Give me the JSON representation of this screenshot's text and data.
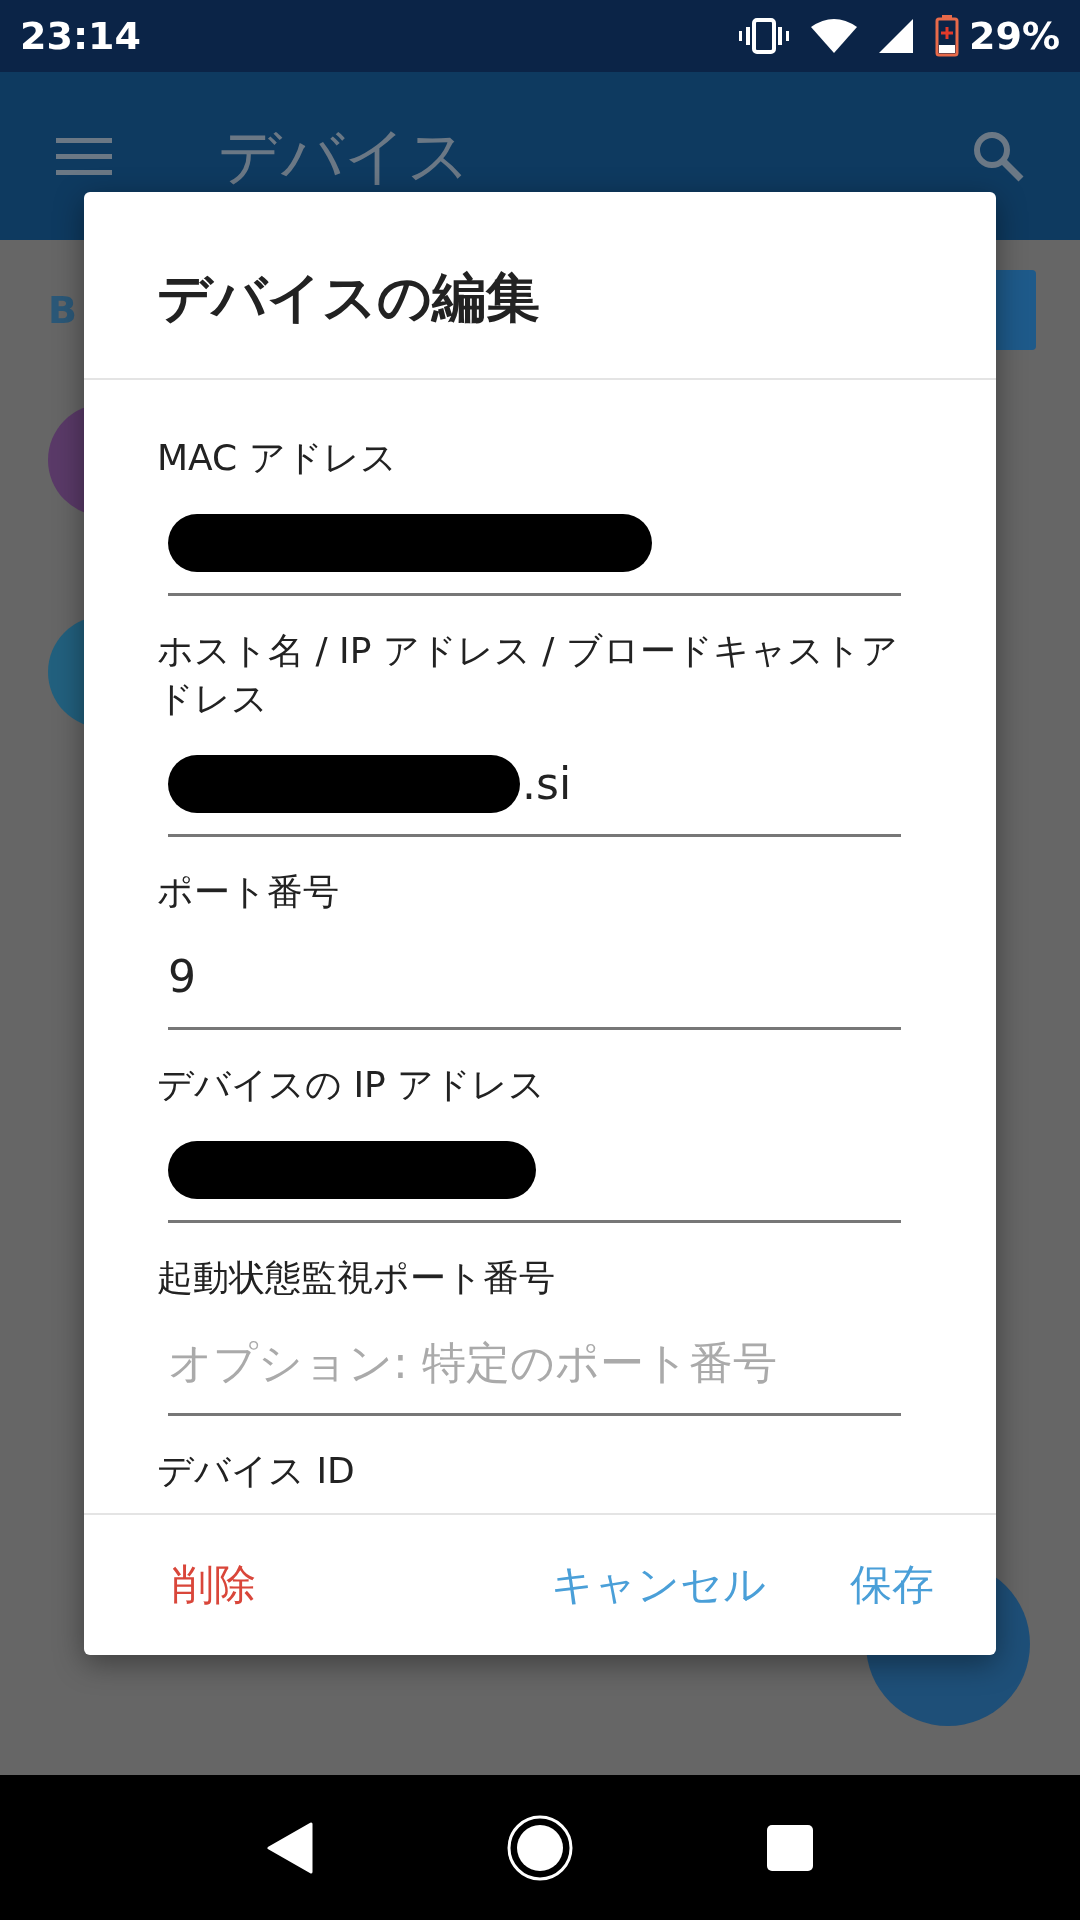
{
  "status_bar": {
    "time": "23:14",
    "battery": "29%"
  },
  "app_bar": {
    "title": "デバイス"
  },
  "background": {
    "section_label": "B"
  },
  "dialog": {
    "title": "デバイスの編集",
    "fields": [
      {
        "label": "MAC アドレス",
        "kind": "redacted"
      },
      {
        "label": "ホスト名 / IP アドレス / ブロードキャストアドレス",
        "kind": "redacted",
        "value": ".si"
      },
      {
        "label": "ポート番号",
        "kind": "text",
        "value": "9"
      },
      {
        "label": "デバイスの IP アドレス",
        "kind": "redacted"
      },
      {
        "label": "起動状態監視ポート番号",
        "kind": "text",
        "placeholder": "オプション: 特定のポート番号"
      },
      {
        "label": "デバイス ID",
        "kind": "label_only"
      }
    ],
    "buttons": [
      {
        "label": "削除",
        "kind": "destructive"
      },
      {
        "label": "キャンセル",
        "kind": "normal"
      },
      {
        "label": "保存",
        "kind": "normal"
      }
    ]
  }
}
